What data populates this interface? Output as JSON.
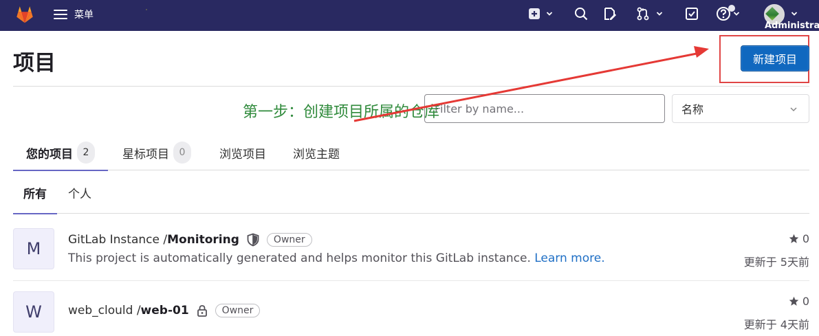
{
  "nav": {
    "menu_label": "菜单",
    "user_name": "Administrator"
  },
  "page": {
    "title": "项目",
    "new_project_button": "新建项目"
  },
  "filter": {
    "placeholder": "Filter by name...",
    "sort_selected": "名称"
  },
  "annotation": {
    "text": "第一步：创建项目所属的仓库",
    "text_color": "#2f8a3b",
    "arrow_color": "#e53935"
  },
  "tabs": [
    {
      "label": "您的项目",
      "count": "2",
      "active": true
    },
    {
      "label": "星标项目",
      "count": "0",
      "active": false
    },
    {
      "label": "浏览项目",
      "active": false
    },
    {
      "label": "浏览主题",
      "active": false
    }
  ],
  "subtabs": [
    {
      "label": "所有",
      "active": true
    },
    {
      "label": "个人",
      "active": false
    }
  ],
  "projects": [
    {
      "avatar_letter": "M",
      "namespace": "GitLab Instance / ",
      "name": "Monitoring",
      "visibility_icon": "shield-icon",
      "role": "Owner",
      "description": "This project is automatically generated and helps monitor this GitLab instance. ",
      "link_text": "Learn more.",
      "stars": "0",
      "updated": "更新于 5天前"
    },
    {
      "avatar_letter": "W",
      "namespace": "web_clould / ",
      "name": "web-01",
      "visibility_icon": "lock-icon",
      "role": "Owner",
      "stars": "0",
      "updated": "更新于 4天前"
    }
  ],
  "colors": {
    "topbar": "#292961",
    "primary_button": "#1068bf",
    "active_tab_underline": "#6666c4",
    "highlight_box": "#e04545"
  },
  "icons": [
    "gitlab-logo",
    "hamburger-icon",
    "plus-square-icon",
    "search-icon",
    "issues-icon",
    "merge-request-icon",
    "todo-icon",
    "help-icon",
    "chevron-down-icon",
    "star-icon"
  ]
}
